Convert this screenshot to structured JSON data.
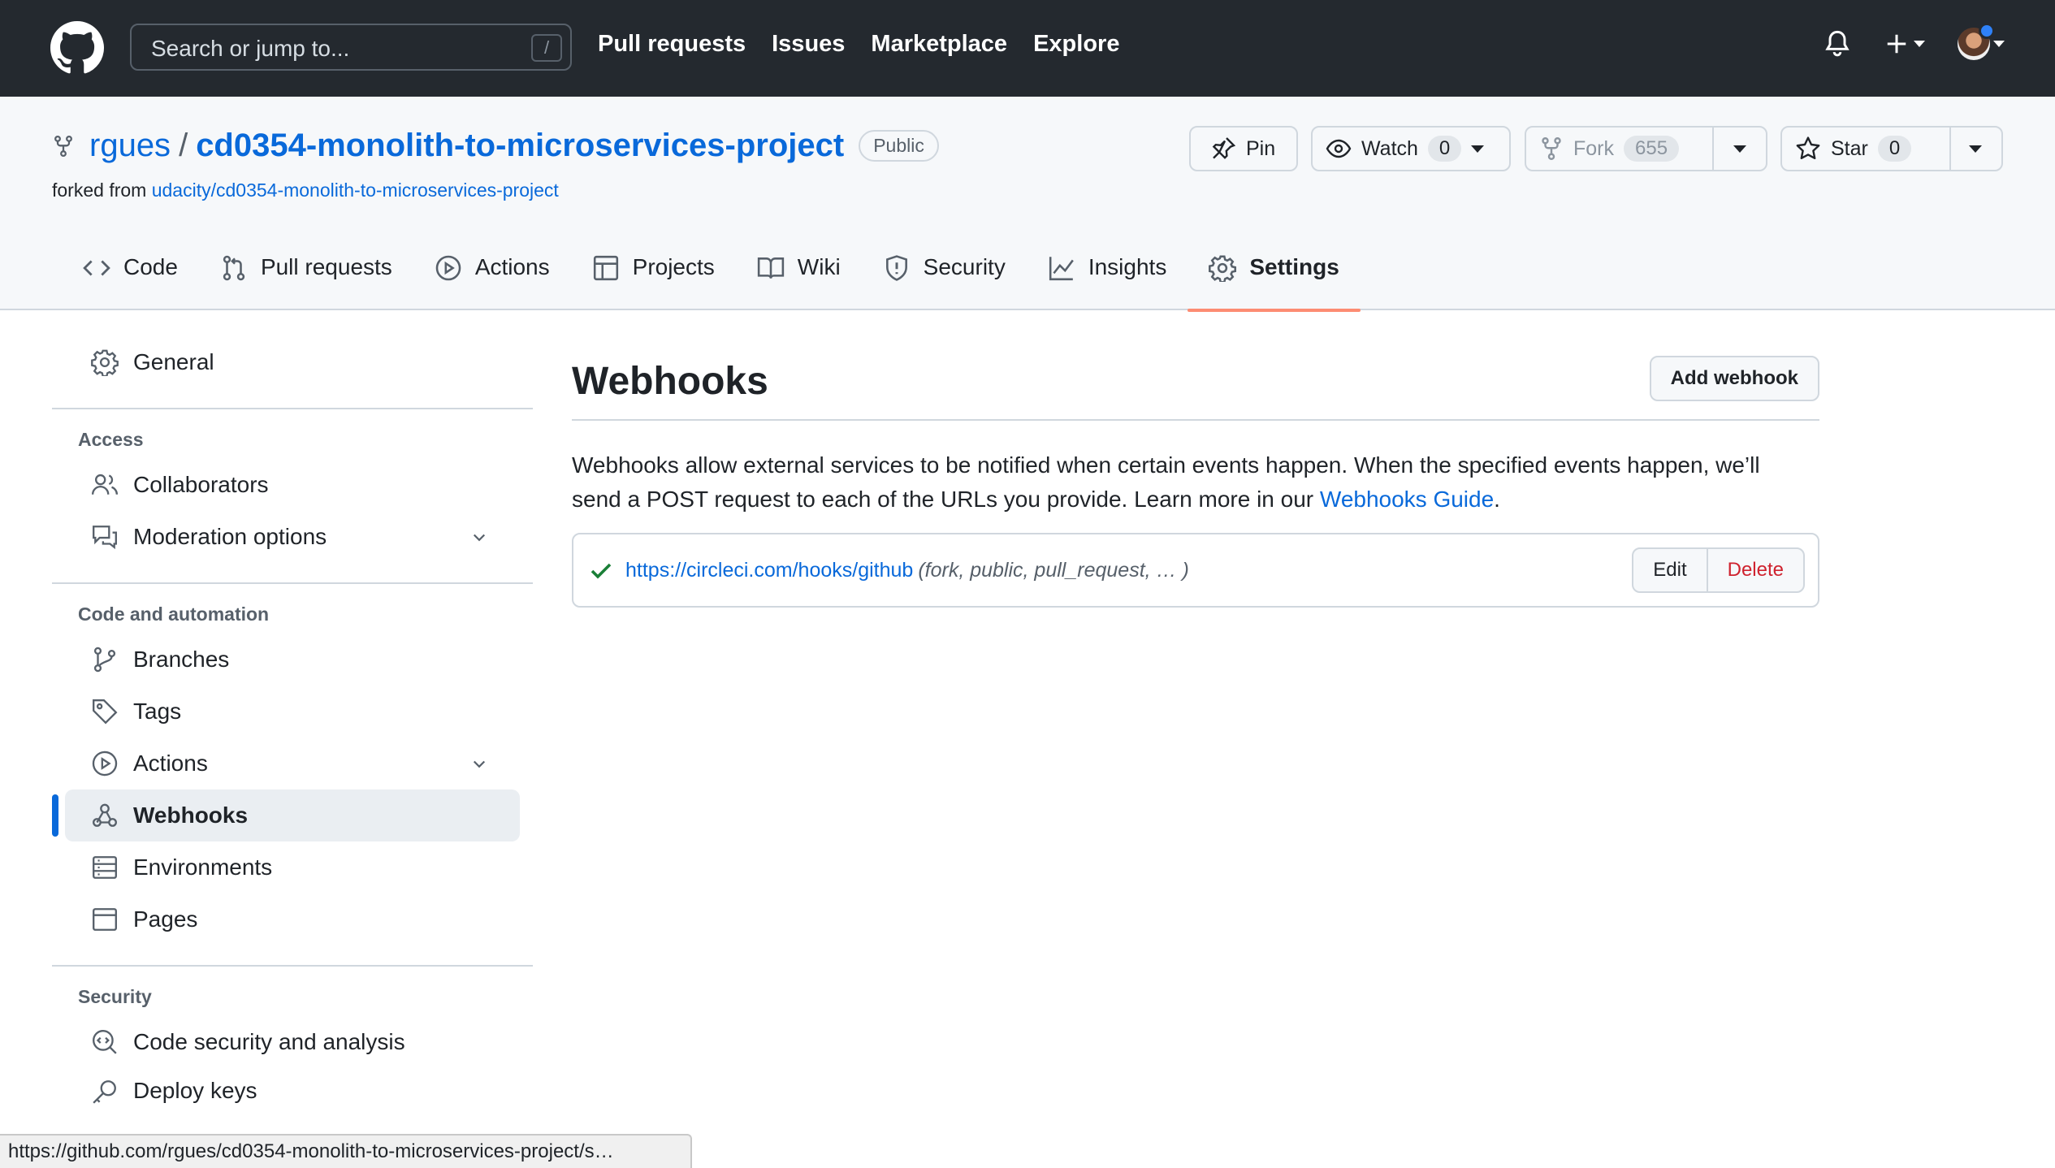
{
  "header": {
    "search_placeholder": "Search or jump to...",
    "search_shortcut": "/",
    "nav": [
      "Pull requests",
      "Issues",
      "Marketplace",
      "Explore"
    ]
  },
  "repo": {
    "owner": "rgues",
    "separator": "/",
    "name": "cd0354-monolith-to-microservices-project",
    "visibility": "Public",
    "forked_from_label": "forked from",
    "forked_from": "udacity/cd0354-monolith-to-microservices-project",
    "pin_label": "Pin",
    "watch_label": "Watch",
    "watch_count": "0",
    "fork_label": "Fork",
    "fork_count": "655",
    "star_label": "Star",
    "star_count": "0"
  },
  "tabs": [
    {
      "label": "Code",
      "icon": "code-icon"
    },
    {
      "label": "Pull requests",
      "icon": "pull-request-icon"
    },
    {
      "label": "Actions",
      "icon": "play-icon"
    },
    {
      "label": "Projects",
      "icon": "table-icon"
    },
    {
      "label": "Wiki",
      "icon": "book-icon"
    },
    {
      "label": "Security",
      "icon": "shield-icon"
    },
    {
      "label": "Insights",
      "icon": "graph-icon"
    },
    {
      "label": "Settings",
      "icon": "gear-icon",
      "active": true
    }
  ],
  "sidebar": {
    "general": "General",
    "access_heading": "Access",
    "collaborators": "Collaborators",
    "moderation": "Moderation options",
    "code_heading": "Code and automation",
    "branches": "Branches",
    "tags": "Tags",
    "actions": "Actions",
    "webhooks": "Webhooks",
    "environments": "Environments",
    "pages": "Pages",
    "security_heading": "Security",
    "code_security": "Code security and analysis",
    "deploy_keys": "Deploy keys"
  },
  "main": {
    "title": "Webhooks",
    "add_button": "Add webhook",
    "description_pre": "Webhooks allow external services to be notified when certain events happen. When the specified events happen, we’ll send a POST request to each of the URLs you provide. Learn more in our ",
    "description_link": "Webhooks Guide",
    "description_post": ".",
    "hook": {
      "url": "https://circleci.com/hooks/github",
      "events": "(fork, public, pull_request, … )",
      "status": "success",
      "edit": "Edit",
      "delete": "Delete"
    }
  },
  "statusbar": "https://github.com/rgues/cd0354-monolith-to-microservices-project/s…",
  "colors": {
    "header_bg": "#24292f",
    "link": "#0969da",
    "active_tab_underline": "#fd8c73",
    "success": "#1a7f37",
    "danger": "#cf222e"
  }
}
